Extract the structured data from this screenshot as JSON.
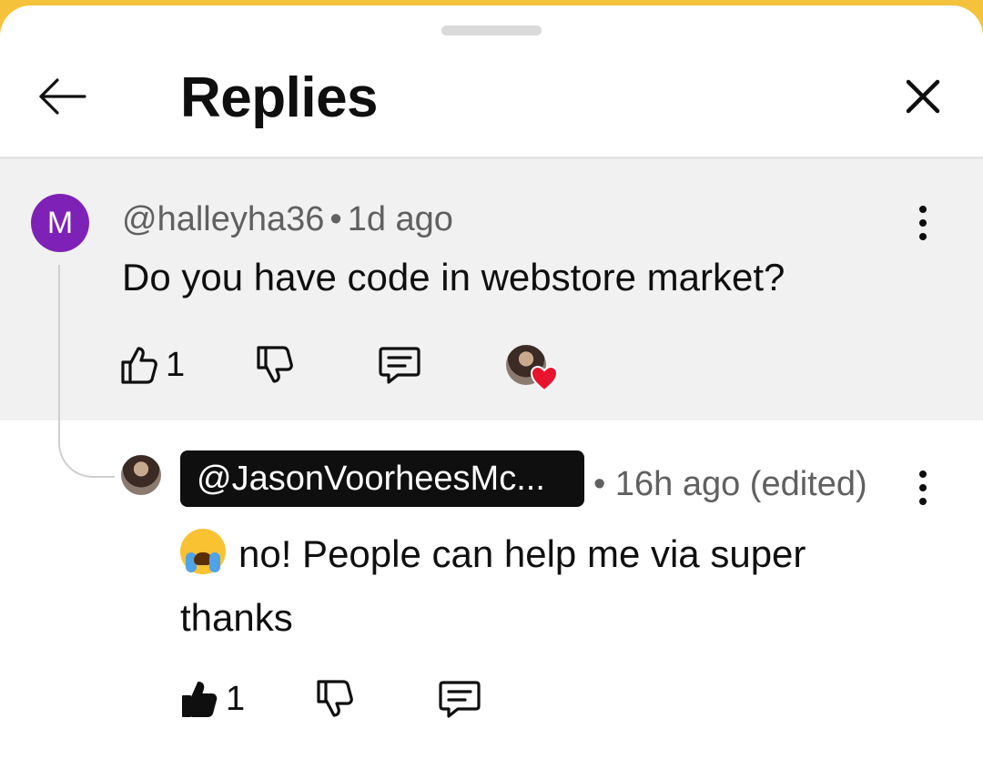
{
  "header": {
    "title": "Replies",
    "back_icon": "arrow-left-icon",
    "close_icon": "close-icon"
  },
  "parent_comment": {
    "avatar_letter": "M",
    "avatar_color": "#7e22b7",
    "handle": "@halleyha36",
    "separator": "•",
    "time": "1d ago",
    "text": "Do you have code in webstore market?",
    "like_count": "1",
    "creator_heart": true
  },
  "reply": {
    "handle": "@JasonVoorheesMc...",
    "separator": "•",
    "time": "16h ago (edited)",
    "emoji": "😭",
    "text": "no! People can help me via super thanks",
    "like_count": "1",
    "liked": true
  },
  "colors": {
    "background_sheet": "#ffffff",
    "parent_background": "#f1f1f1",
    "heart": "#e8142d",
    "top_strip": "#f5c33b"
  }
}
